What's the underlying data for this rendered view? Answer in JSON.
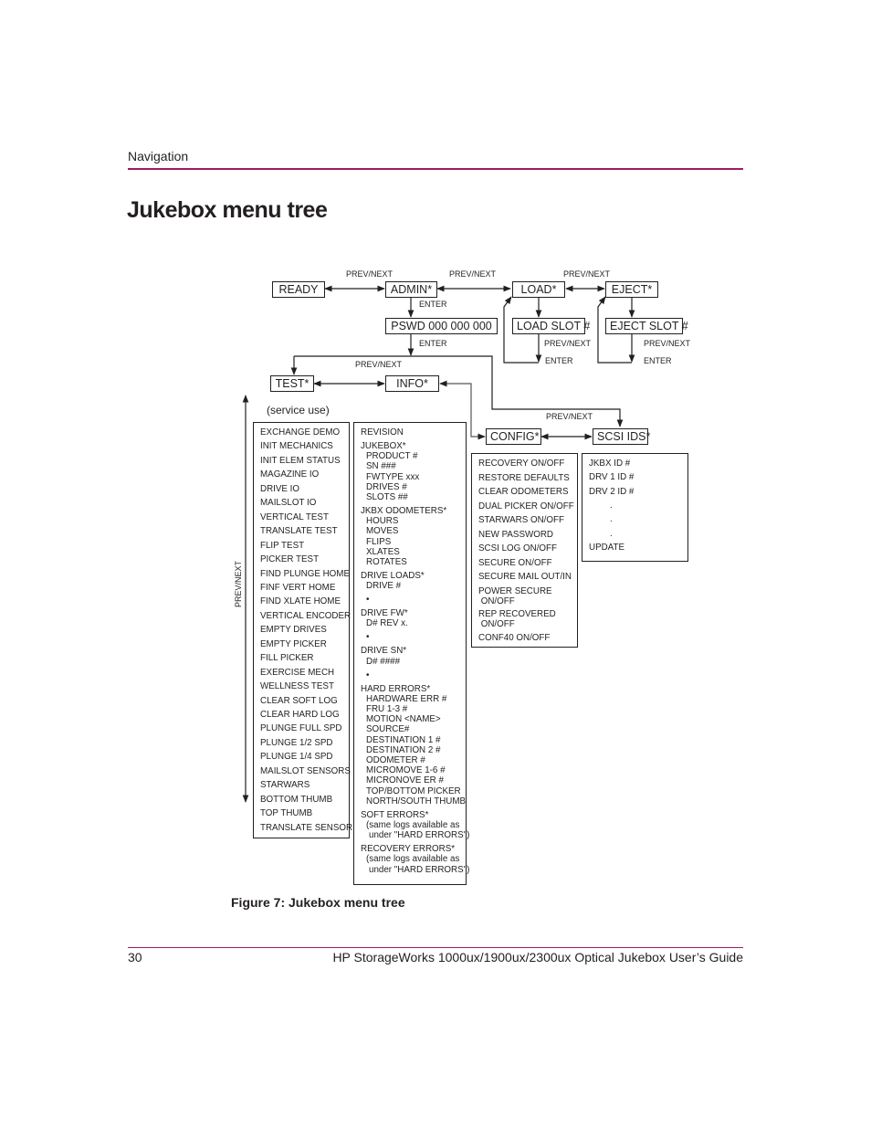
{
  "header": {
    "section": "Navigation"
  },
  "page": {
    "title": "Jukebox menu tree"
  },
  "figure": {
    "caption": "Figure 7:  Jukebox menu tree"
  },
  "footer": {
    "page_number": "30",
    "guide_title": "HP StorageWorks 1000ux/1900ux/2300ux Optical Jukebox User’s Guide"
  },
  "colors": {
    "accent_rule": "#9b1b63",
    "text": "#231f20"
  },
  "diagram": {
    "nodes": {
      "ready": "READY",
      "admin": "ADMIN*",
      "load": "LOAD*",
      "eject": "EJECT*",
      "pswd": "PSWD 000 000 000",
      "load_slot": "LOAD SLOT #",
      "eject_slot": "EJECT SLOT #",
      "test": "TEST*",
      "info": "INFO*",
      "config": "CONFIG*",
      "scsi_ids": "SCSI IDS*"
    },
    "labels": {
      "prev_next": "PREV/NEXT",
      "enter": "ENTER",
      "service_use": "(service use)"
    },
    "test_menu": [
      "EXCHANGE DEMO",
      "INIT MECHANICS",
      "INIT ELEM STATUS",
      "MAGAZINE IO",
      "DRIVE IO",
      "MAILSLOT IO",
      "VERTICAL TEST",
      "TRANSLATE TEST",
      "FLIP TEST",
      "PICKER TEST",
      "FIND PLUNGE HOME",
      "FINF VERT HOME",
      "FIND XLATE HOME",
      "VERTICAL ENCODER",
      "EMPTY DRIVES",
      "EMPTY PICKER",
      "FILL PICKER",
      "EXERCISE MECH",
      "WELLNESS TEST",
      "CLEAR SOFT LOG",
      "CLEAR HARD LOG",
      "PLUNGE FULL SPD",
      "PLUNGE 1/2 SPD",
      "PLUNGE 1/4 SPD",
      "MAILSLOT SENSORS",
      "STARWARS",
      "BOTTOM THUMB",
      "TOP THUMB",
      "TRANSLATE SENSOR"
    ],
    "info_menu": [
      {
        "t": "REVISION",
        "i": 0
      },
      {
        "t": "JUKEBOX*",
        "i": 0
      },
      {
        "t": "PRODUCT #",
        "i": 1
      },
      {
        "t": "SN ###",
        "i": 1
      },
      {
        "t": "FWTYPE xxx",
        "i": 1
      },
      {
        "t": "DRIVES #",
        "i": 1
      },
      {
        "t": "SLOTS ##",
        "i": 1
      },
      {
        "t": "JKBX ODOMETERS*",
        "i": 0
      },
      {
        "t": "HOURS",
        "i": 1
      },
      {
        "t": "MOVES",
        "i": 1
      },
      {
        "t": "FLIPS",
        "i": 1
      },
      {
        "t": "XLATES",
        "i": 1
      },
      {
        "t": "ROTATES",
        "i": 1
      },
      {
        "t": "DRIVE LOADS*",
        "i": 0
      },
      {
        "t": "DRIVE #",
        "i": 1
      },
      {
        "t": "•",
        "i": 1
      },
      {
        "t": "DRIVE FW*",
        "i": 0
      },
      {
        "t": "D# REV x.",
        "i": 1
      },
      {
        "t": "•",
        "i": 1
      },
      {
        "t": "DRIVE SN*",
        "i": 0
      },
      {
        "t": "D# ####",
        "i": 1
      },
      {
        "t": "•",
        "i": 1
      },
      {
        "t": "HARD ERRORS*",
        "i": 0
      },
      {
        "t": "HARDWARE ERR #",
        "i": 1
      },
      {
        "t": "FRU 1-3 #",
        "i": 1
      },
      {
        "t": "MOTION <NAME>",
        "i": 1
      },
      {
        "t": "SOURCE#",
        "i": 1
      },
      {
        "t": "DESTINATION 1 #",
        "i": 1
      },
      {
        "t": "DESTINATION 2 #",
        "i": 1
      },
      {
        "t": "ODOMETER #",
        "i": 1
      },
      {
        "t": "MICROMOVE 1-6 #",
        "i": 1
      },
      {
        "t": "MICRONOVE ER #",
        "i": 1
      },
      {
        "t": "TOP/BOTTOM PICKER",
        "i": 1
      },
      {
        "t": "NORTH/SOUTH THUMB",
        "i": 1
      },
      {
        "t": "SOFT ERRORS*",
        "i": 0
      },
      {
        "t": "(same logs available as",
        "i": 1
      },
      {
        "t": "under \"HARD ERRORS\")",
        "i": 2
      },
      {
        "t": "RECOVERY ERRORS*",
        "i": 0
      },
      {
        "t": "(same logs available as",
        "i": 1
      },
      {
        "t": "under \"HARD ERRORS\")",
        "i": 2
      }
    ],
    "config_menu": [
      "RECOVERY ON/OFF",
      "RESTORE DEFAULTS",
      "CLEAR ODOMETERS",
      "DUAL PICKER ON/OFF",
      "STARWARS ON/OFF",
      "NEW PASSWORD",
      "SCSI LOG ON/OFF",
      "SECURE ON/OFF",
      "SECURE MAIL OUT/IN",
      "POWER SECURE\n ON/OFF",
      "REP RECOVERED\n ON/OFF",
      "CONF40 ON/OFF"
    ],
    "scsi_menu": [
      "JKBX ID #",
      "DRV 1 ID #",
      "DRV 2 ID #",
      ".",
      ".",
      ".",
      "UPDATE"
    ]
  }
}
